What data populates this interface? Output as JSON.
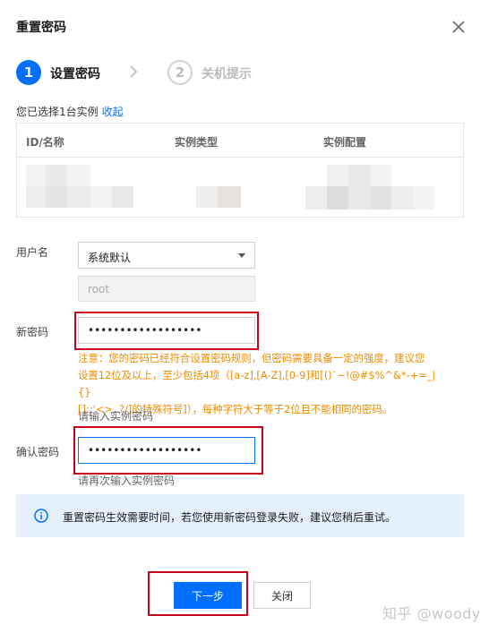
{
  "dialog": {
    "title": "重置密码"
  },
  "steps": [
    {
      "number": "1",
      "label": "设置密码"
    },
    {
      "number": "2",
      "label": "关机提示"
    }
  ],
  "selection": {
    "text": "您已选择1台实例",
    "collapse_label": "收起"
  },
  "table": {
    "columns": [
      "ID/名称",
      "实例类型",
      "实例配置"
    ]
  },
  "form": {
    "username_label": "用户名",
    "username_select": "系统默认",
    "username_value": "root",
    "new_password_label": "新密码",
    "new_password_value": "••••••••••••••••••",
    "warning": "注意：您的密码已经符合设置密码规则，但密码需要具备一定的强度，建议您\n设置12位及以上，至少包括4项（[a-z],[A-Z],[0-9]和[()`~!@#$%^&*-+=_|{}\n[]:;'<>,.?/]的特殊符号]），每种字符大于等于2位且不能相同的密码。",
    "new_password_hint": "请输入实例密码",
    "confirm_password_label": "确认密码",
    "confirm_password_value": "••••••••••••••••••",
    "confirm_password_hint": "请再次输入实例密码"
  },
  "info": {
    "text": "重置密码生效需要时间，若您使用新密码登录失败，建议您稍后重试。"
  },
  "buttons": {
    "next": "下一步",
    "close": "关闭"
  },
  "watermark": "知乎 @woody",
  "colors": {
    "primary": "#006eff",
    "warning": "#f08c00",
    "highlight_box": "#c8001e",
    "info_bg": "#e5f0ff"
  },
  "icons": {
    "close": "close-icon",
    "step_arrow": "chevron-right-icon",
    "dropdown": "caret-down-icon",
    "info": "info-circle-icon"
  }
}
